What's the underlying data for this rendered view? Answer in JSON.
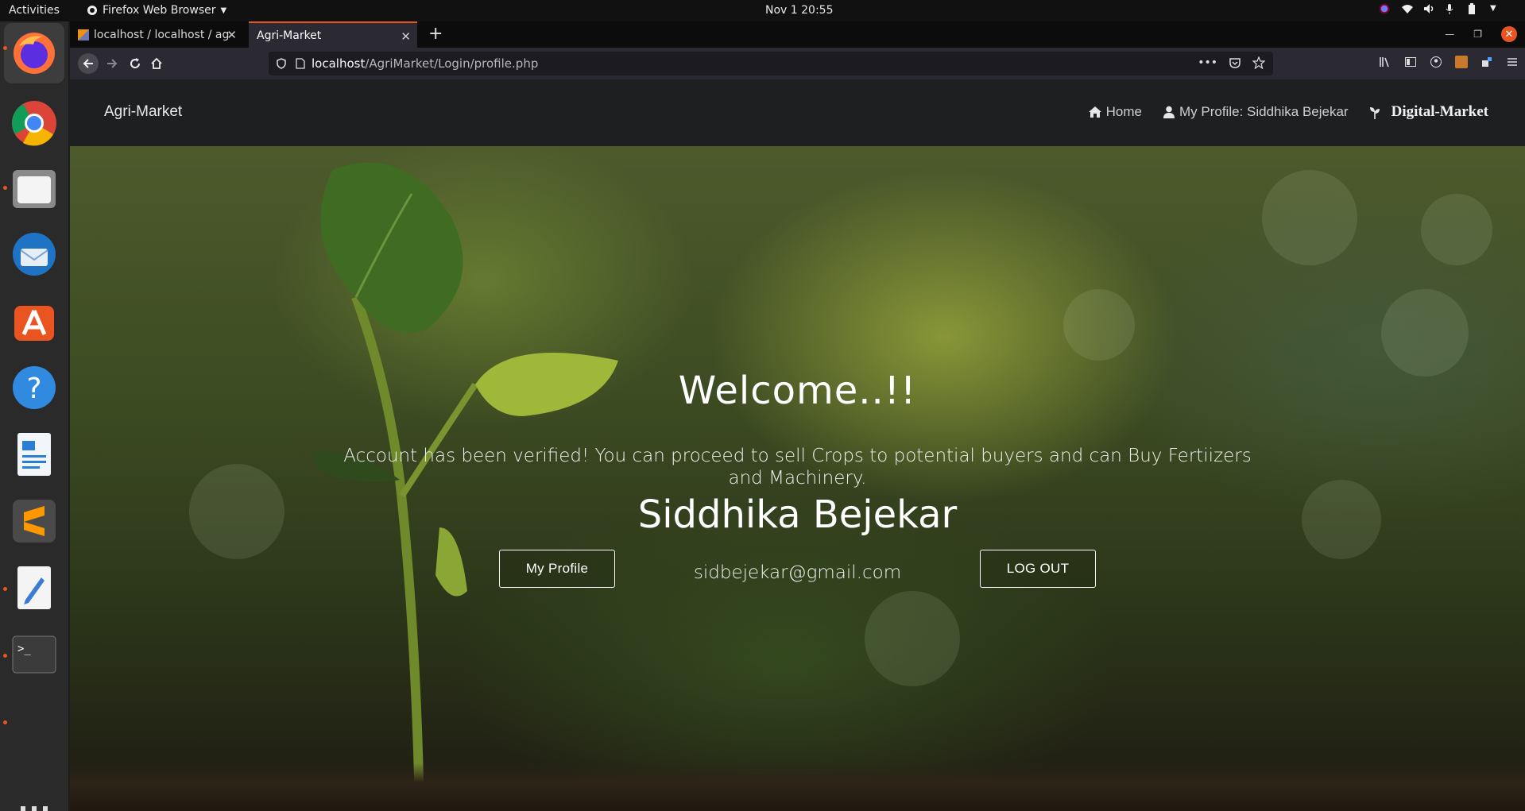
{
  "system": {
    "activities": "Activities",
    "app_menu": "Firefox Web Browser",
    "clock": "Nov 1  20:55"
  },
  "dock": {
    "apps": [
      "firefox-icon",
      "chrome-icon",
      "files-icon",
      "thunderbird-icon",
      "software-center-icon",
      "help-icon",
      "libreoffice-writer-icon",
      "sublime-text-icon",
      "text-editor-icon",
      "terminal-icon"
    ]
  },
  "browser": {
    "tabs": [
      {
        "label": "localhost / localhost / ag"
      },
      {
        "label": "Agri-Market"
      }
    ],
    "url_host": "localhost",
    "url_path": "/AgriMarket/Login/profile.php"
  },
  "site": {
    "brand": "Agri-Market",
    "nav": {
      "home": "Home",
      "profile": "My Profile: Siddhika Bejekar",
      "digital_market": "Digital-Market"
    },
    "hero": {
      "title": "Welcome..!!",
      "message": "Account has been verified! You can proceed to sell Crops to potential buyers and can Buy Fertiizers and Machinery.",
      "name": "Siddhika Bejekar",
      "email": "sidbejekar@gmail.com",
      "profile_button": "My Profile",
      "logout_button": "LOG OUT"
    }
  },
  "colors": {
    "accent": "#e95420",
    "site_nav_bg": "#1d1f20",
    "tab_active_bg": "#2b2a33"
  }
}
